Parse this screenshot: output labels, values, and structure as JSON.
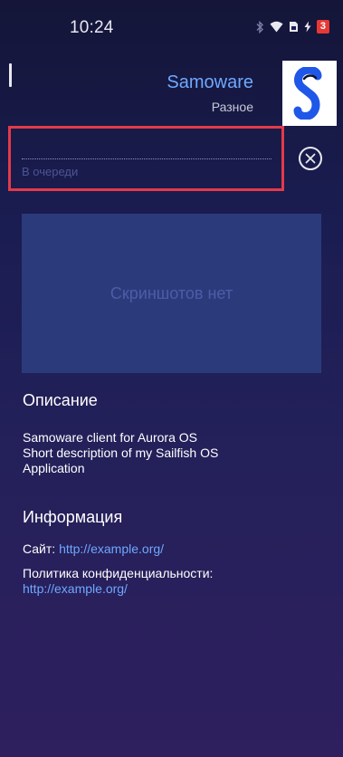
{
  "status_bar": {
    "time": "10:24",
    "battery_level": "3"
  },
  "app": {
    "name": "Samoware",
    "category": "Разное",
    "logo_icon": "samoware-logo"
  },
  "queue": {
    "status": "В очереди",
    "progress": 0
  },
  "screenshots": {
    "empty_label": "Скриншотов нет"
  },
  "description": {
    "heading": "Описание",
    "lines": [
      "Samoware client for Aurora OS",
      "Short description of my Sailfish OS",
      "Application"
    ]
  },
  "info": {
    "heading": "Информация",
    "site_label": "Сайт:",
    "site_url": "http://example.org/",
    "privacy_label": "Политика конфиденциальности:",
    "privacy_url": "http://example.org/"
  },
  "colors": {
    "accent": "#6fa8ff",
    "highlight_border": "#e23a4a",
    "battery": "#e53935"
  }
}
